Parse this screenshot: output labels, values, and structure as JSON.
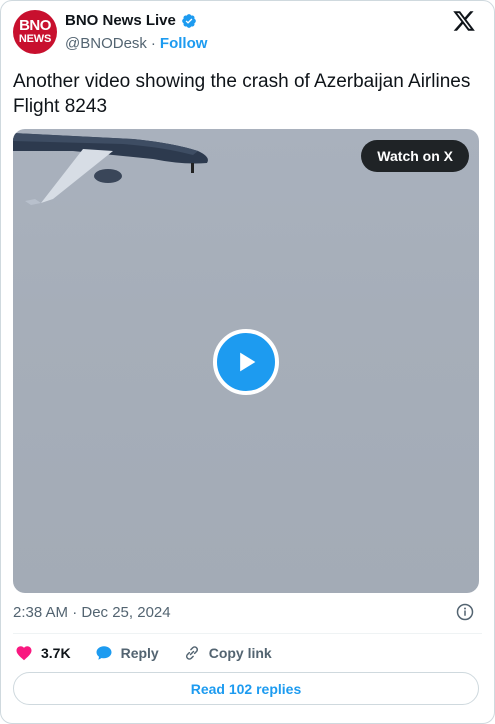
{
  "author": {
    "display_name": "BNO News Live",
    "handle": "@BNODesk",
    "separator": "·",
    "follow_label": "Follow",
    "avatar_line1": "BNO",
    "avatar_line2": "NEWS"
  },
  "tweet": {
    "text": "Another video showing the crash of Azerbaijan Airlines Flight 8243",
    "timestamp": "2:38 AM · Dec 25, 2024"
  },
  "video": {
    "watch_label": "Watch on X"
  },
  "actions": {
    "likes_count": "3.7K",
    "reply_label": "Reply",
    "copy_link_label": "Copy link"
  },
  "footer": {
    "read_replies_label": "Read 102 replies"
  },
  "colors": {
    "accent": "#1d9bf0",
    "like": "#f91880",
    "avatar_bg": "#c8102e"
  },
  "icons": [
    "verified-badge-icon",
    "x-logo-icon",
    "play-icon",
    "info-icon",
    "heart-icon",
    "reply-bubble-icon",
    "link-icon"
  ]
}
